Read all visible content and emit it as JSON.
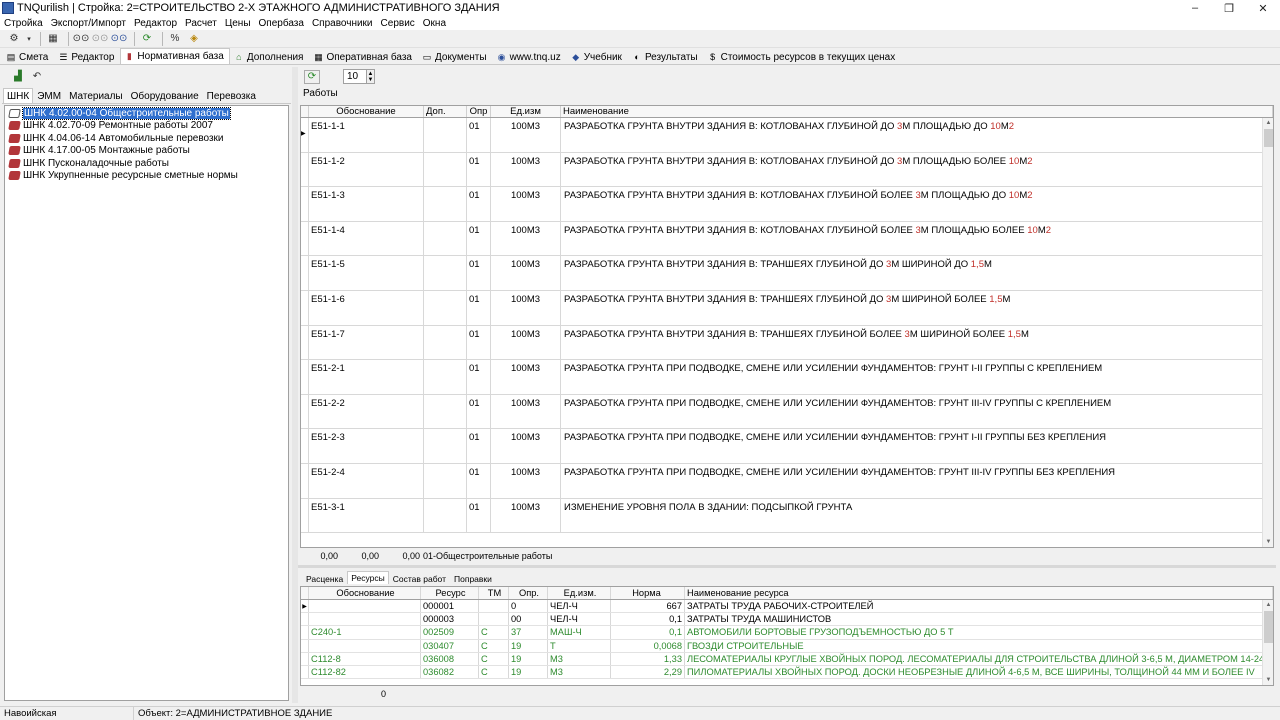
{
  "window": {
    "title": "TNQurilish  | Стройка: 2=СТРОИТЕЛЬСТВО 2-Х ЭТАЖНОГО АДМИНИСТРАТИВНОГО ЗДАНИЯ",
    "minimize": "–",
    "maximize": "❐",
    "close": "✕"
  },
  "menu": [
    "Стройка",
    "Экспорт/Импорт",
    "Редактор",
    "Расчет",
    "Цены",
    "Опербаза",
    "Справочники",
    "Сервис",
    "Окна"
  ],
  "toolbar_icons": [
    "gear-icon",
    "grid-icon",
    "binoculars-icon",
    "binoculars-gray-icon",
    "binoculars-blue-icon",
    "refresh-icon",
    "percent-icon",
    "tag-icon"
  ],
  "main_tabs": [
    {
      "label": "Смета",
      "icon": "calculator-icon"
    },
    {
      "label": "Редактор",
      "icon": "list-icon"
    },
    {
      "label": "Нормативная база",
      "icon": "books-icon",
      "active": true
    },
    {
      "label": "Дополнения",
      "icon": "house-icon"
    },
    {
      "label": "Оперативная база",
      "icon": "table-icon"
    },
    {
      "label": "Документы",
      "icon": "document-icon"
    },
    {
      "label": "www.tnq.uz",
      "icon": "globe-icon"
    },
    {
      "label": "Учебник",
      "icon": "diamond-icon"
    },
    {
      "label": "Результаты",
      "icon": "results-icon"
    },
    {
      "label": "Стоимость ресурсов в текущих ценах",
      "icon": "dollar-icon"
    }
  ],
  "left": {
    "tabs": [
      {
        "label": "ШНК",
        "active": true
      },
      {
        "label": "ЭММ"
      },
      {
        "label": "Материалы"
      },
      {
        "label": "Оборудование"
      },
      {
        "label": "Перевозка"
      }
    ],
    "tree": [
      {
        "label": "ШНК 4.02.00-04 Общестроительные работы",
        "selected": true
      },
      {
        "label": "ШНК 4.02.70-09 Ремонтные работы 2007"
      },
      {
        "label": "ШНК 4.04.06-14 Автомобильные перевозки"
      },
      {
        "label": "ШНК 4.17.00-05 Монтажные работы"
      },
      {
        "label": "ШНК Пусконаладочные работы"
      },
      {
        "label": "ШНК Укрупненные ресурсные сметные нормы"
      }
    ]
  },
  "right": {
    "page_size": "10",
    "section_label": "Работы",
    "columns": {
      "code": "Обоснование",
      "dop": "Доп.",
      "opr": "Опр",
      "unit": "Ед.изм",
      "name": "Наименование"
    },
    "rows": [
      {
        "code": "Е51-1-1",
        "opr": "01",
        "unit": "100М3",
        "name": [
          "РАЗРАБОТКА ГРУНТА ВНУТРИ ЗДАНИЯ В: КОТЛОВАНАХ ГЛУБИНОЙ ДО ",
          "3",
          "М ПЛОЩАДЬЮ ДО ",
          "10",
          "М",
          "2",
          ""
        ]
      },
      {
        "code": "Е51-1-2",
        "opr": "01",
        "unit": "100М3",
        "name": [
          "РАЗРАБОТКА ГРУНТА ВНУТРИ ЗДАНИЯ В: КОТЛОВАНАХ ГЛУБИНОЙ ДО ",
          "3",
          "М ПЛОЩАДЬЮ БОЛЕЕ ",
          "10",
          "М",
          "2",
          ""
        ]
      },
      {
        "code": "Е51-1-3",
        "opr": "01",
        "unit": "100М3",
        "name": [
          "РАЗРАБОТКА ГРУНТА ВНУТРИ ЗДАНИЯ В: КОТЛОВАНАХ ГЛУБИНОЙ БОЛЕЕ ",
          "3",
          "М ПЛОЩАДЬЮ ДО ",
          "10",
          "М",
          "2",
          ""
        ]
      },
      {
        "code": "Е51-1-4",
        "opr": "01",
        "unit": "100М3",
        "name": [
          "РАЗРАБОТКА ГРУНТА ВНУТРИ ЗДАНИЯ В: КОТЛОВАНАХ ГЛУБИНОЙ БОЛЕЕ ",
          "3",
          "М ПЛОЩАДЬЮ БОЛЕЕ ",
          "10",
          "М",
          "2",
          ""
        ]
      },
      {
        "code": "Е51-1-5",
        "opr": "01",
        "unit": "100М3",
        "name": [
          "РАЗРАБОТКА ГРУНТА ВНУТРИ ЗДАНИЯ В: ТРАНШЕЯХ ГЛУБИНОЙ ДО ",
          "3",
          "М ШИРИНОЙ ДО ",
          "1,5",
          "М",
          "",
          ""
        ]
      },
      {
        "code": "Е51-1-6",
        "opr": "01",
        "unit": "100М3",
        "name": [
          "РАЗРАБОТКА ГРУНТА ВНУТРИ ЗДАНИЯ В: ТРАНШЕЯХ ГЛУБИНОЙ ДО ",
          "3",
          "М ШИРИНОЙ БОЛЕЕ ",
          "1,5",
          "М",
          "",
          ""
        ]
      },
      {
        "code": "Е51-1-7",
        "opr": "01",
        "unit": "100М3",
        "name": [
          "РАЗРАБОТКА ГРУНТА ВНУТРИ ЗДАНИЯ В: ТРАНШЕЯХ ГЛУБИНОЙ БОЛЕЕ ",
          "3",
          "М ШИРИНОЙ БОЛЕЕ ",
          "1,5",
          "М",
          "",
          ""
        ]
      },
      {
        "code": "Е51-2-1",
        "opr": "01",
        "unit": "100М3",
        "name": [
          "РАЗРАБОТКА ГРУНТА ПРИ ПОДВОДКЕ, СМЕНЕ ИЛИ УСИЛЕНИИ ФУНДАМЕНТОВ: ГРУНТ I-II ГРУППЫ С КРЕПЛЕНИЕМ",
          "",
          "",
          "",
          "",
          "",
          ""
        ]
      },
      {
        "code": "Е51-2-2",
        "opr": "01",
        "unit": "100М3",
        "name": [
          "РАЗРАБОТКА ГРУНТА ПРИ ПОДВОДКЕ, СМЕНЕ ИЛИ УСИЛЕНИИ ФУНДАМЕНТОВ: ГРУНТ III-IV ГРУППЫ С КРЕПЛЕНИЕМ",
          "",
          "",
          "",
          "",
          "",
          ""
        ]
      },
      {
        "code": "Е51-2-3",
        "opr": "01",
        "unit": "100М3",
        "name": [
          "РАЗРАБОТКА ГРУНТА ПРИ ПОДВОДКЕ, СМЕНЕ ИЛИ УСИЛЕНИИ ФУНДАМЕНТОВ: ГРУНТ I-II ГРУППЫ БЕЗ КРЕПЛЕНИЯ",
          "",
          "",
          "",
          "",
          "",
          ""
        ]
      },
      {
        "code": "Е51-2-4",
        "opr": "01",
        "unit": "100М3",
        "name": [
          "РАЗРАБОТКА ГРУНТА ПРИ ПОДВОДКЕ, СМЕНЕ ИЛИ УСИЛЕНИИ ФУНДАМЕНТОВ: ГРУНТ III-IV ГРУППЫ БЕЗ КРЕПЛЕНИЯ",
          "",
          "",
          "",
          "",
          "",
          ""
        ]
      },
      {
        "code": "Е51-3-1",
        "opr": "01",
        "unit": "100М3",
        "name": [
          "ИЗМЕНЕНИЕ УРОВНЯ ПОЛА В ЗДАНИИ: ПОДСЫПКОЙ ГРУНТА",
          "",
          "",
          "",
          "",
          "",
          ""
        ]
      }
    ],
    "totals": [
      "0,00",
      "0,00",
      "0,00"
    ],
    "totals_label": "01-Общестроительные работы",
    "bottom_tabs": [
      {
        "label": "Расценка"
      },
      {
        "label": "Ресурсы",
        "active": true
      },
      {
        "label": "Состав работ"
      },
      {
        "label": "Поправки"
      }
    ],
    "res_columns": {
      "code": "Обоснование",
      "res": "Ресурс",
      "tm": "ТМ",
      "opr": "Опр.",
      "unit": "Ед.изм.",
      "norm": "Норма",
      "name": "Наименование ресурса"
    },
    "resources": [
      {
        "code": "",
        "res": "000001",
        "tm": "",
        "opr": "0",
        "unit": "ЧЕЛ-Ч",
        "norm": "667",
        "name": "ЗАТРАТЫ ТРУДА РАБОЧИХ-СТРОИТЕЛЕЙ",
        "green": false
      },
      {
        "code": "",
        "res": "000003",
        "tm": "",
        "opr": "00",
        "unit": "ЧЕЛ-Ч",
        "norm": "0,1",
        "name": "ЗАТРАТЫ ТРУДА МАШИНИСТОВ",
        "green": false
      },
      {
        "code": "С240-1",
        "res": "002509",
        "tm": "С",
        "opr": "37",
        "unit": "МАШ-Ч",
        "norm": "0,1",
        "name": "АВТОМОБИЛИ БОРТОВЫЕ ГРУЗОПОДЪЕМНОСТЬЮ ДО 5 Т",
        "green": true
      },
      {
        "code": "",
        "res": "030407",
        "tm": "С",
        "opr": "19",
        "unit": "Т",
        "norm": "0,0068",
        "name": "ГВОЗДИ СТРОИТЕЛЬНЫЕ",
        "green": true
      },
      {
        "code": "С112-8",
        "res": "036008",
        "tm": "С",
        "opr": "19",
        "unit": "М3",
        "norm": "1,33",
        "name": "ЛЕСОМАТЕРИАЛЫ КРУГЛЫЕ ХВОЙНЫХ ПОРОД. ЛЕСОМАТЕРИАЛЫ ДЛЯ СТРОИТЕЛЬСТВА ДЛИНОЙ 3-6,5 М, ДИАМЕТРОМ 14-24",
        "green": true
      },
      {
        "code": "С112-82",
        "res": "036082",
        "tm": "С",
        "opr": "19",
        "unit": "М3",
        "norm": "2,29",
        "name": "ПИЛОМАТЕРИАЛЫ ХВОЙНЫХ ПОРОД. ДОСКИ НЕОБРЕЗНЫЕ ДЛИНОЙ 4-6,5 М, ВСЕ ШИРИНЫ, ТОЛЩИНОЙ 44 ММ И БОЛЕЕ IV",
        "green": true
      }
    ],
    "res_footer": "0"
  },
  "status": {
    "region": "Навоийская",
    "object": "Объект: 2=АДМИНИСТРАТИВНОЕ ЗДАНИЕ"
  }
}
